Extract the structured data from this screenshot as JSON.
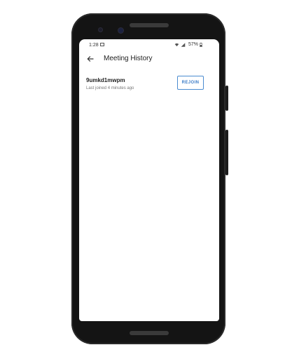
{
  "status_bar": {
    "time": "1:28",
    "battery": "57%"
  },
  "app_bar": {
    "title": "Meeting History"
  },
  "meetings": [
    {
      "code": "9umkd1mwpm",
      "last_joined": "Last joined 4 minutes ago",
      "action_label": "REJOIN"
    }
  ],
  "icons": {
    "back": "arrow-left-icon",
    "image_notification": "image-icon",
    "wifi": "wifi-icon",
    "signal": "signal-icon",
    "battery": "battery-icon"
  },
  "colors": {
    "accent": "#3c7cc7",
    "phone_body": "#141414",
    "screen_bg": "#ffffff"
  }
}
